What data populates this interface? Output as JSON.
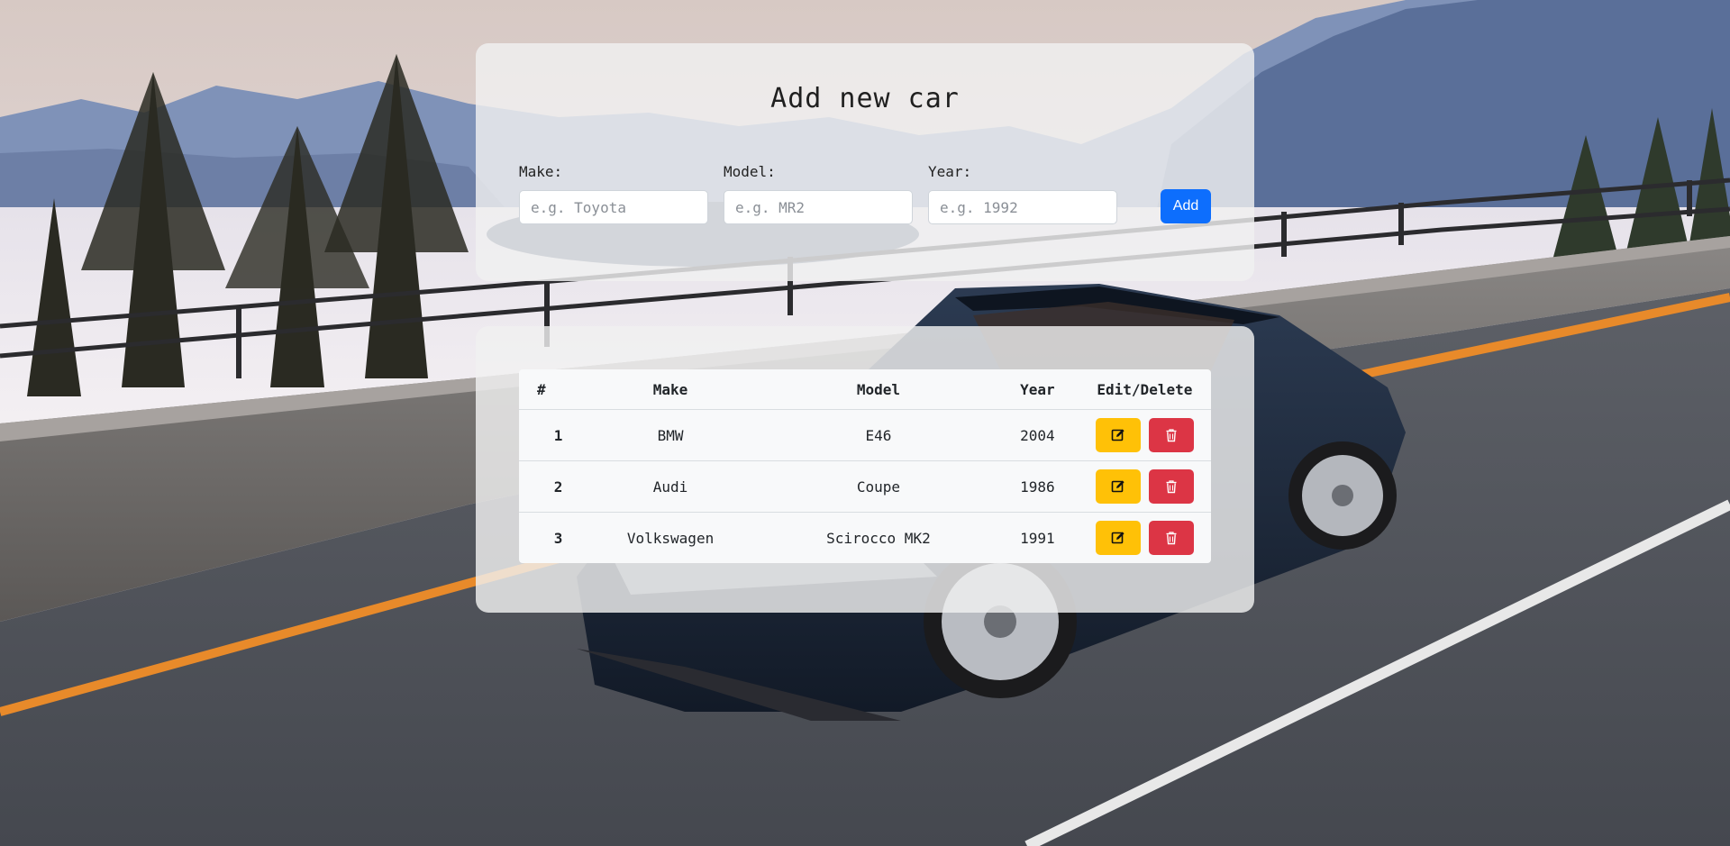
{
  "form": {
    "title": "Add new car",
    "fields": [
      {
        "label": "Make:",
        "placeholder": "e.g. Toyota"
      },
      {
        "label": "Model:",
        "placeholder": "e.g. MR2"
      },
      {
        "label": "Year:",
        "placeholder": "e.g. 1992"
      }
    ],
    "add_label": "Add"
  },
  "table": {
    "headers": [
      "#",
      "Make",
      "Model",
      "Year",
      "Edit/Delete"
    ],
    "rows": [
      {
        "index": "1",
        "make": "BMW",
        "model": "E46",
        "year": "2004"
      },
      {
        "index": "2",
        "make": "Audi",
        "model": "Coupe",
        "year": "1986"
      },
      {
        "index": "3",
        "make": "Volkswagen",
        "model": "Scirocco MK2",
        "year": "1991"
      }
    ]
  },
  "icons": {
    "edit": "pencil-square-icon",
    "delete": "trash-icon"
  },
  "colors": {
    "primary": "#0d6efd",
    "edit": "#ffc107",
    "delete": "#dc3545"
  }
}
